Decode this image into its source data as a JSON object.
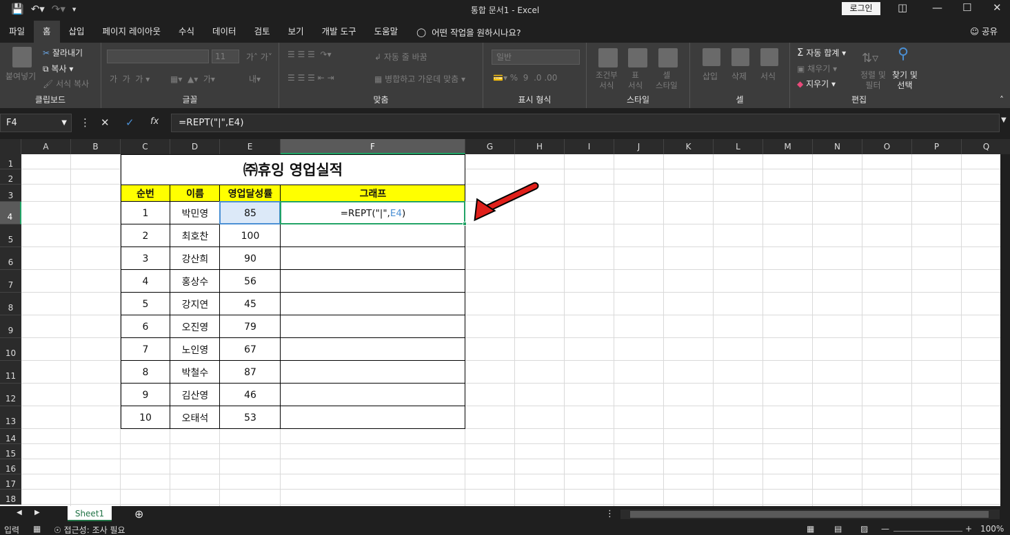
{
  "window": {
    "title": "통합 문서1  -  Excel",
    "login_label": "로그인"
  },
  "menu": {
    "tabs": [
      "파일",
      "홈",
      "삽입",
      "페이지 레이아웃",
      "수식",
      "데이터",
      "검토",
      "보기",
      "개발 도구",
      "도움말"
    ],
    "active": "홈",
    "tell_me": "어떤 작업을 원하시나요?",
    "share": "공유"
  },
  "ribbon": {
    "clipboard": {
      "label": "클립보드",
      "paste": "붙여넣기",
      "cut": "잘라내기",
      "copy": "복사",
      "format_painter": "서식 복사"
    },
    "font": {
      "label": "글꼴",
      "size": "11"
    },
    "alignment": {
      "label": "맞춤",
      "wrap": "자동 줄 바꿈",
      "merge": "병합하고 가운데 맞춤"
    },
    "number": {
      "label": "표시 형식",
      "format": "일반"
    },
    "styles": {
      "label": "스타일",
      "conditional": "조건부\n서식",
      "table": "표\n서식",
      "cell_styles": "셀\n스타일"
    },
    "cells": {
      "label": "셀",
      "insert": "삽입",
      "delete": "삭제",
      "format": "서식"
    },
    "editing": {
      "label": "편집",
      "autosum": "자동 합계",
      "fill": "채우기",
      "clear": "지우기",
      "sort": "정렬 및\n필터",
      "find": "찾기 및\n선택"
    }
  },
  "formula_bar": {
    "name_box": "F4",
    "formula": "=REPT(\"|\",E4)"
  },
  "sheet": {
    "columns": [
      "A",
      "B",
      "C",
      "D",
      "E",
      "F",
      "G",
      "H",
      "I",
      "J",
      "K",
      "L",
      "M",
      "N",
      "O",
      "P",
      "Q"
    ],
    "rows": [
      "1",
      "2",
      "3",
      "4",
      "5",
      "6",
      "7",
      "8",
      "9",
      "10",
      "11",
      "12",
      "13",
      "14",
      "15",
      "16",
      "17",
      "18"
    ],
    "selected_col": "F",
    "selected_row": "4",
    "title": "㈜휴잉 영업실적",
    "headers": [
      "순번",
      "이름",
      "영업달성률",
      "그래프"
    ],
    "data": [
      {
        "no": "1",
        "name": "박민영",
        "rate": "85"
      },
      {
        "no": "2",
        "name": "최호찬",
        "rate": "100"
      },
      {
        "no": "3",
        "name": "강산희",
        "rate": "90"
      },
      {
        "no": "4",
        "name": "홍상수",
        "rate": "56"
      },
      {
        "no": "5",
        "name": "강지연",
        "rate": "45"
      },
      {
        "no": "6",
        "name": "오진영",
        "rate": "79"
      },
      {
        "no": "7",
        "name": "노인영",
        "rate": "67"
      },
      {
        "no": "8",
        "name": "박철수",
        "rate": "87"
      },
      {
        "no": "9",
        "name": "김산영",
        "rate": "46"
      },
      {
        "no": "10",
        "name": "오태석",
        "rate": "53"
      }
    ],
    "edit_cell": {
      "prefix": "=REPT(\"|\",",
      "ref": "E4",
      "suffix": ")"
    }
  },
  "sheet_tabs": {
    "active": "Sheet1"
  },
  "status": {
    "mode": "입력",
    "accessibility": "접근성: 조사 필요",
    "zoom": "100%"
  },
  "colors": {
    "accent": "#21a366",
    "header_fill": "#ffff00",
    "arrow": "#e0201b",
    "ref_blue": "#4a8fd4"
  }
}
